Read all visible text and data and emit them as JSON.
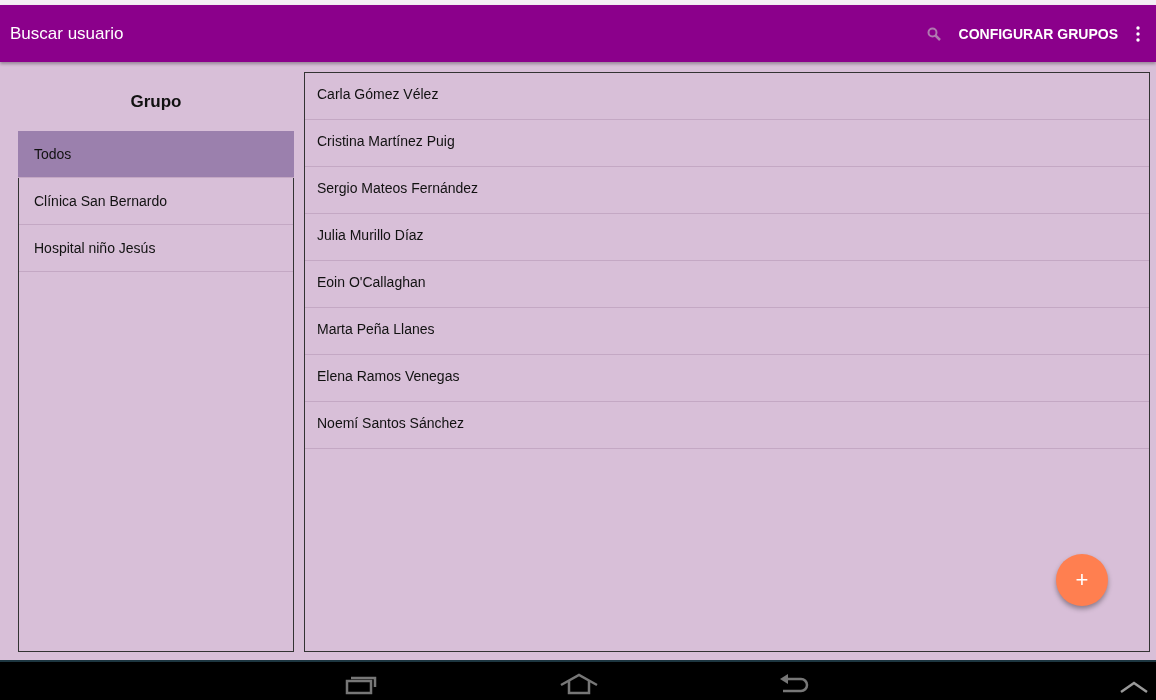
{
  "app_bar": {
    "title": "Buscar usuario",
    "action": "CONFIGURAR GRUPOS"
  },
  "groups": {
    "heading": "Grupo",
    "items": [
      {
        "label": "Todos",
        "selected": true
      },
      {
        "label": "Clínica San Bernardo",
        "selected": false
      },
      {
        "label": "Hospital niño Jesús",
        "selected": false
      }
    ]
  },
  "users": [
    "Carla Gómez Vélez",
    "Cristina Martínez Puig",
    "Sergio Mateos Fernández",
    "Julia Murillo Díaz",
    "Eoin O'Callaghan",
    "Marta Peña Llanes",
    "Elena Ramos Venegas",
    "Noemí Santos Sánchez"
  ],
  "fab": {
    "label": "+"
  }
}
